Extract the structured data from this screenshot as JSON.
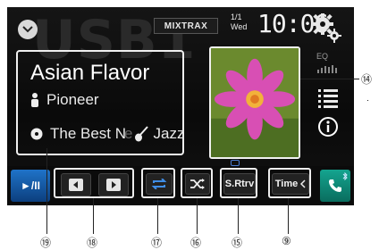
{
  "header": {
    "source_bg": "USB1",
    "mixtrax_label": "MIXTRAX",
    "date_top": "1/1",
    "date_day": "Wed",
    "clock": "10:06"
  },
  "track": {
    "title": "Asian Flavor",
    "artist": "Pioneer",
    "album_visible": "The Best N",
    "album_faded": "e",
    "genre": "Jazz"
  },
  "side": {
    "eq_label": "EQ"
  },
  "toolbar": {
    "play_pause": "►/II",
    "sound_retriever": "S.Rtrv",
    "time_label": "Time"
  },
  "callouts": [
    "⑭",
    "⑲",
    "⑱",
    "⑰",
    "⑯",
    "⑮",
    "⑨"
  ],
  "colors": {
    "play_button": "#1f73c8",
    "phone_button": "#14a48f",
    "repeat_icon": "#3f8de6",
    "info_icon_ring": "#ffffff"
  },
  "icons": [
    "down-arrow-icon",
    "gear-icon",
    "eq-icon",
    "list-icon",
    "info-icon",
    "prev-track-icon",
    "next-track-icon",
    "repeat-icon",
    "shuffle-icon",
    "phone-icon",
    "bluetooth-icon",
    "person-icon",
    "disc-icon",
    "guitar-icon"
  ]
}
